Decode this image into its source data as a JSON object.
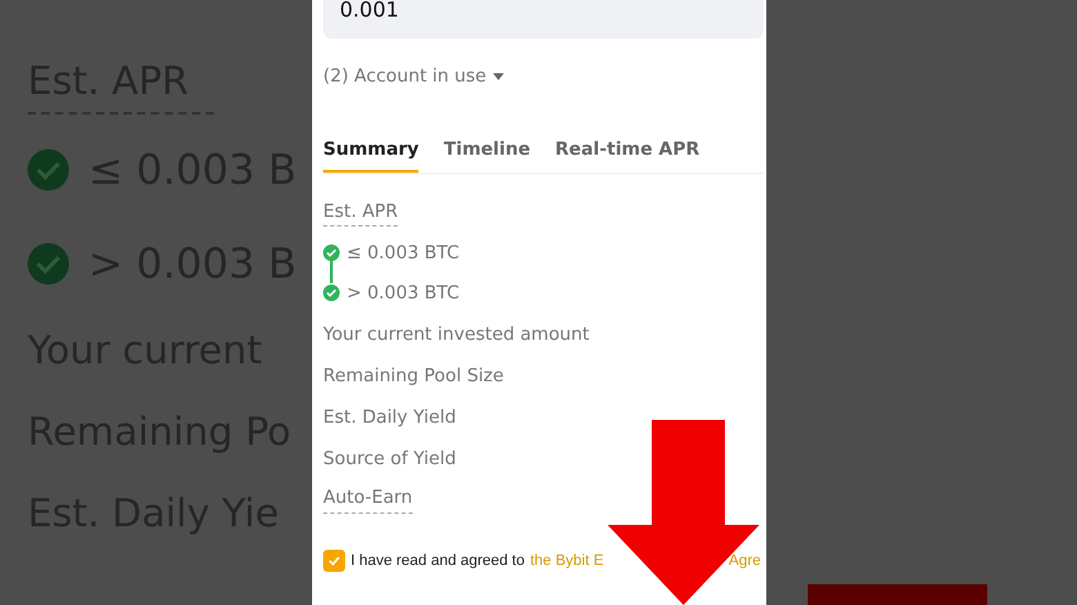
{
  "backdrop": {
    "left_texts": [
      {
        "kind": "heading",
        "text": "Est. APR"
      },
      {
        "kind": "tier",
        "text": "≤ 0.003 B"
      },
      {
        "kind": "tier",
        "text": "> 0.003 B"
      },
      {
        "kind": "label",
        "text": "Your current"
      },
      {
        "kind": "label",
        "text": "Remaining Po"
      },
      {
        "kind": "label",
        "text": "Est. Daily Yie"
      }
    ]
  },
  "amount_field": {
    "value": "0.001"
  },
  "account": {
    "label": "(2) Account in use"
  },
  "tabs": [
    {
      "label": "Summary",
      "selected": true
    },
    {
      "label": "Timeline",
      "selected": false
    },
    {
      "label": "Real-time APR",
      "selected": false
    }
  ],
  "est_apr": {
    "label": "Est. APR",
    "tiers": [
      "≤ 0.003 BTC",
      "> 0.003 BTC"
    ]
  },
  "details": [
    {
      "label": "Your current invested amount",
      "dotted": false
    },
    {
      "label": "Remaining Pool Size",
      "dotted": false
    },
    {
      "label": "Est. Daily Yield",
      "dotted": false
    },
    {
      "label": "Source of Yield",
      "dotted": false
    },
    {
      "label": "Auto-Earn",
      "dotted": true
    }
  ],
  "agreement": {
    "checked": true,
    "text": "I have read and agreed to",
    "link": "the Bybit E",
    "link_end": "Agre"
  }
}
